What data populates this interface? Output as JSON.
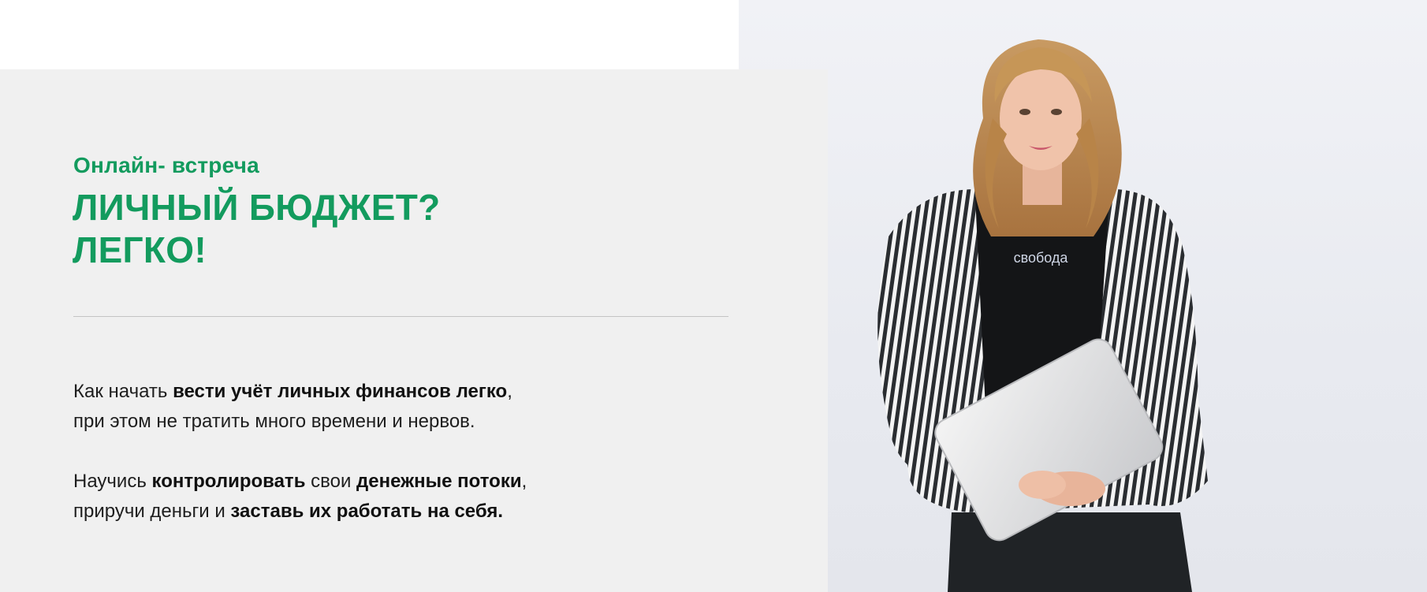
{
  "hero": {
    "eyebrow": "Онлайн- встреча",
    "headline": [
      "ЛИЧНЫЙ БЮДЖЕТ?",
      "ЛЕГКО!"
    ],
    "shirt_text": "свобода",
    "paragraph1": {
      "line1": {
        "pre": "Как начать ",
        "bold": "вести учёт личных финансов легко",
        "post": ","
      },
      "line2": "при этом не тратить много времени и нервов."
    },
    "paragraph2": {
      "line1": {
        "pre": "Научись ",
        "bold1": "контролировать",
        "mid": " свои ",
        "bold2": "денежные потоки",
        "post": ","
      },
      "line2": {
        "pre": "приручи деньги и ",
        "bold": "заставь их работать на себя."
      }
    }
  },
  "colors": {
    "accent": "#139b5e",
    "panel_bg": "#f0f0f0",
    "text": "#1e1e1e"
  }
}
